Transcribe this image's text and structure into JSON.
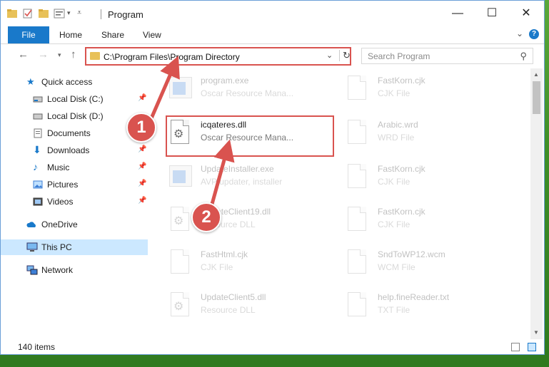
{
  "window": {
    "title": "Program",
    "controls": {
      "minimize": "—",
      "maximize": "☐",
      "close": "✕"
    }
  },
  "ribbon": {
    "tabs": [
      "File",
      "Home",
      "Share",
      "View"
    ],
    "help": "?"
  },
  "address": {
    "path": "C:\\Program Files\\Program Directory",
    "search_placeholder": "Search Program"
  },
  "sidebar": {
    "items": [
      {
        "label": "Quick access",
        "icon": "star-icon"
      },
      {
        "label": "Local Disk (C:)",
        "icon": "drive-icon"
      },
      {
        "label": "Local Disk (D:)",
        "icon": "drive-icon"
      },
      {
        "label": "Documents",
        "icon": "documents-icon"
      },
      {
        "label": "Downloads",
        "icon": "download-arrow-icon"
      },
      {
        "label": "Music",
        "icon": "music-note-icon"
      },
      {
        "label": "Pictures",
        "icon": "pictures-icon"
      },
      {
        "label": "Videos",
        "icon": "videos-icon"
      },
      {
        "label": "OneDrive",
        "icon": "cloud-icon"
      },
      {
        "label": "This PC",
        "icon": "computer-icon"
      },
      {
        "label": "Network",
        "icon": "network-icon"
      }
    ]
  },
  "files": {
    "left": [
      {
        "name": "program.exe",
        "desc": "Oscar Resource Mana..."
      },
      {
        "name": "icqateres.dll",
        "desc": "Oscar Resource Mana..."
      },
      {
        "name": "UpdateInstaller.exe",
        "desc": "AVP updater, installer"
      },
      {
        "name": "UpdateClient19.dll",
        "desc": "Resource DLL"
      },
      {
        "name": "FastHtml.cjk",
        "desc": "CJK File"
      },
      {
        "name": "UpdateClient5.dll",
        "desc": "Resource DLL"
      }
    ],
    "right": [
      {
        "name": "FastKorn.cjk",
        "desc": "CJK File"
      },
      {
        "name": "Arabic.wrd",
        "desc": "WRD File"
      },
      {
        "name": "FastKorn.cjk",
        "desc": "CJK File"
      },
      {
        "name": "FastKorn.cjk",
        "desc": "CJK File"
      },
      {
        "name": "SndToWP12.wcm",
        "desc": "WCM File"
      },
      {
        "name": "help.fineReader.txt",
        "desc": "TXT File"
      }
    ]
  },
  "status": {
    "count": "140 items"
  },
  "annotations": {
    "step1": "1",
    "step2": "2"
  },
  "colors": {
    "accent": "#1979ca",
    "annotation": "#d9534f"
  }
}
